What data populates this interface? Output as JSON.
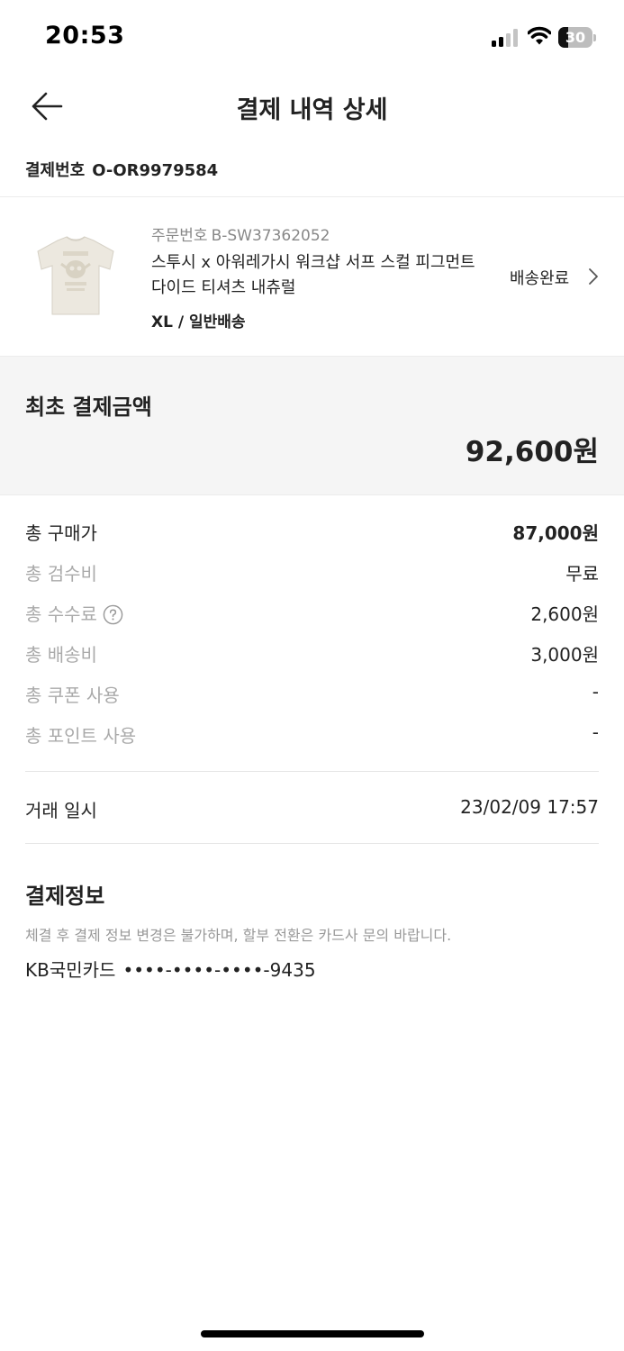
{
  "status_bar": {
    "time": "20:53",
    "battery": "30",
    "battery_level": 0.3
  },
  "nav": {
    "title": "결제 내역 상세"
  },
  "payment_number": {
    "label": "결제번호",
    "value": "O-OR9979584"
  },
  "product": {
    "order_label": "주문번호",
    "order_number": "B-SW37362052",
    "name": "스투시 x 아워레가시 워크샵 서프 스컬 피그먼트 다이드 티셔츠 내츄럴",
    "option": "XL / 일반배송",
    "status": "배송완료"
  },
  "initial_payment": {
    "label": "최초 결제금액",
    "amount": "92,600원"
  },
  "breakdown": [
    {
      "label": "총 구매가",
      "value": "87,000원"
    },
    {
      "label": "총 검수비",
      "value": "무료"
    },
    {
      "label": "총 수수료",
      "value": "2,600원"
    },
    {
      "label": "총 배송비",
      "value": "3,000원"
    },
    {
      "label": "총 쿠폰 사용",
      "value": "-"
    },
    {
      "label": "총 포인트 사용",
      "value": "-"
    }
  ],
  "trade": {
    "label": "거래 일시",
    "value": "23/02/09 17:57"
  },
  "payment_info": {
    "title": "결제정보",
    "note": "체결 후 결제 정보 변경은 불가하며, 할부 전환은 카드사 문의 바랍니다.",
    "card_name": "KB국민카드",
    "card_number": "••••-••••-••••-9435"
  }
}
